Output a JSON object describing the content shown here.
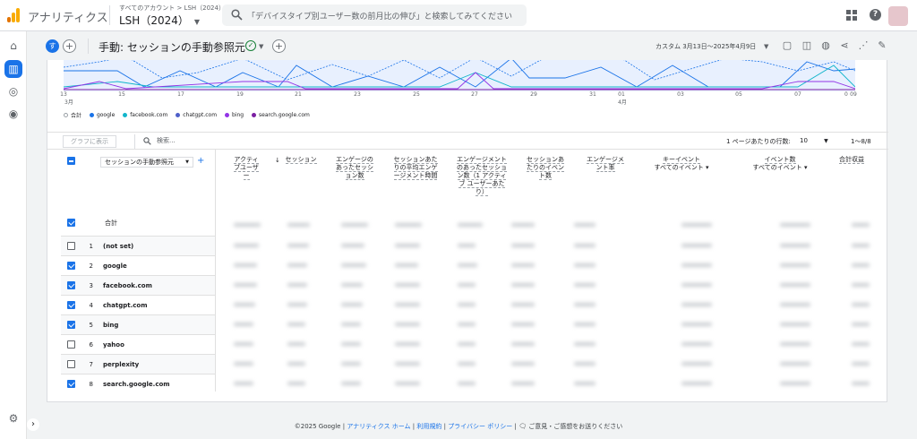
{
  "topbar": {
    "app_title": "アナリティクス",
    "account_crumb": "すべてのアカウント > LSH（2024）",
    "property": "LSH（2024）",
    "search_placeholder": "「デバイスタイプ別ユーザー数の前月比の伸び」と検索してみてください",
    "brand_color": "#f9ab00"
  },
  "header": {
    "segment_badge": "す",
    "title": "手動: セッションの手動参照元",
    "date_range": "カスタム  3月13日～2025年4月9日"
  },
  "chart": {
    "x_ticks": [
      "13",
      "15",
      "17",
      "19",
      "21",
      "23",
      "25",
      "27",
      "29",
      "31",
      "01",
      "03",
      "05",
      "07",
      "09"
    ],
    "month_start": "3月",
    "month_april": "4月",
    "y_zero": "0",
    "legend": [
      {
        "label": "合計",
        "color": "#9aa0a6",
        "hollow": true
      },
      {
        "label": "google",
        "color": "#1a73e8"
      },
      {
        "label": "facebook.com",
        "color": "#12b5cb"
      },
      {
        "label": "chatgpt.com",
        "color": "#4e5fc9"
      },
      {
        "label": "bing",
        "color": "#9334e6"
      },
      {
        "label": "search.google.com",
        "color": "#7b1fa2"
      }
    ]
  },
  "table": {
    "plot_button": "グラフに表示",
    "search_label": "検索...",
    "rows_per_page_label": "1 ページあたりの行数:",
    "rows_per_page": "10",
    "range": "1～8/8",
    "dimension": "セッションの手動参照元",
    "columns": [
      "アクティブユーザー",
      "セッション",
      "エンゲージのあったセッション数",
      "セッションあたりの平均エンゲージメント時間",
      "エンゲージメントのあったセッション数（1 アクティブ ユーザーあたり）",
      "セッションあたりのイベント数",
      "エンゲージメント率",
      "キーイベント",
      "イベント数",
      "合計収益"
    ],
    "sub_all_events": "すべてのイベント",
    "total_label": "合計",
    "rows": [
      {
        "num": "1",
        "label": "(not set)",
        "checked": false
      },
      {
        "num": "2",
        "label": "google",
        "checked": true
      },
      {
        "num": "3",
        "label": "facebook.com",
        "checked": true
      },
      {
        "num": "4",
        "label": "chatgpt.com",
        "checked": true
      },
      {
        "num": "5",
        "label": "bing",
        "checked": true
      },
      {
        "num": "6",
        "label": "yahoo",
        "checked": false
      },
      {
        "num": "7",
        "label": "perplexity",
        "checked": false
      },
      {
        "num": "8",
        "label": "search.google.com",
        "checked": true
      }
    ]
  },
  "footer": {
    "copyright": "©2025 Google",
    "home": "アナリティクス ホーム",
    "terms": "利用規約",
    "privacy": "プライバシー ポリシー",
    "feedback": "ご意見・ご感想をお送りください"
  }
}
